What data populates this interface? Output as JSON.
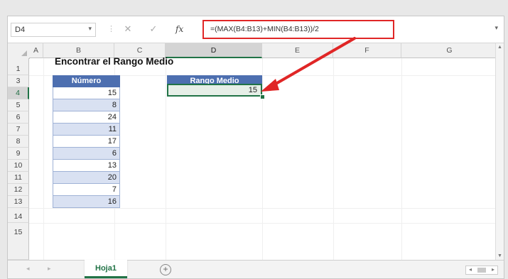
{
  "formula_bar": {
    "name_box": "D4",
    "formula": "=(MAX(B4:B13)+MIN(B4:B13))/2",
    "cancel_glyph": "✕",
    "enter_glyph": "✓",
    "fx_glyph": "fx"
  },
  "columns": [
    "A",
    "B",
    "C",
    "D",
    "E",
    "F",
    "G"
  ],
  "active_column": "D",
  "rows": [
    "1",
    "3",
    "4",
    "5",
    "6",
    "7",
    "8",
    "9",
    "10",
    "11",
    "12",
    "13",
    "14",
    "15"
  ],
  "active_row": "4",
  "sheet": {
    "title": "Encontrar el Rango Medio",
    "table_header": "Número",
    "numbers": [
      "15",
      "8",
      "24",
      "11",
      "17",
      "6",
      "13",
      "20",
      "7",
      "16"
    ],
    "result_header": "Rango Medio",
    "result_value": "15"
  },
  "tabs": {
    "active_sheet": "Hoja1",
    "add_glyph": "+"
  },
  "colors": {
    "accent_green": "#217346",
    "header_blue": "#4d6fb0",
    "band_blue": "#d9e1f2",
    "annotation_red": "#e02626"
  },
  "icons": [
    "name-box-dropdown-icon",
    "cancel-icon",
    "enter-icon",
    "insert-function-icon",
    "expand-formula-icon",
    "select-all-icon",
    "add-sheet-icon",
    "annotation-arrow"
  ]
}
